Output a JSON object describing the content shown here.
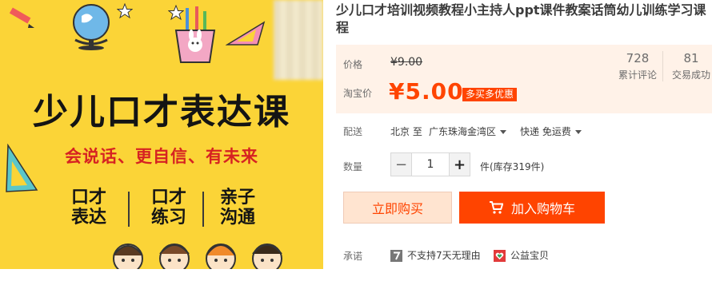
{
  "image": {
    "title": "少儿口才表达课",
    "subtitle": "会说话、更自信、有未来",
    "pillars": [
      {
        "line1": "口才",
        "line2": "表达"
      },
      {
        "line1": "口才",
        "line2": "练习"
      },
      {
        "line1": "亲子",
        "line2": "沟通"
      }
    ]
  },
  "product": {
    "title": "少儿口才培训视频教程小主持人ppt课件教案话筒幼儿训练学习课程"
  },
  "price": {
    "label": "价格",
    "original": "¥9.00",
    "taobao_label": "淘宝价",
    "current": "¥5.00",
    "badge": "多买多优惠"
  },
  "stats": {
    "reviews": {
      "value": "728",
      "label": "累计评论"
    },
    "sales": {
      "value": "81",
      "label": "交易成功"
    }
  },
  "delivery": {
    "label": "配送",
    "from": "北京 至",
    "to": "广东珠海金湾区",
    "method": "快递 免运费"
  },
  "quantity": {
    "label": "数量",
    "minus": "−",
    "value": "1",
    "plus": "+",
    "stock": "件(库存319件)"
  },
  "actions": {
    "buy_now": "立即购买",
    "add_to_cart": "加入购物车"
  },
  "promise": {
    "label": "承诺",
    "items": [
      "不支持7天无理由",
      "公益宝贝"
    ]
  },
  "colors": {
    "accent": "#ff4400",
    "price_bg": "#fff2e8",
    "hero_bg": "#fbd437"
  }
}
